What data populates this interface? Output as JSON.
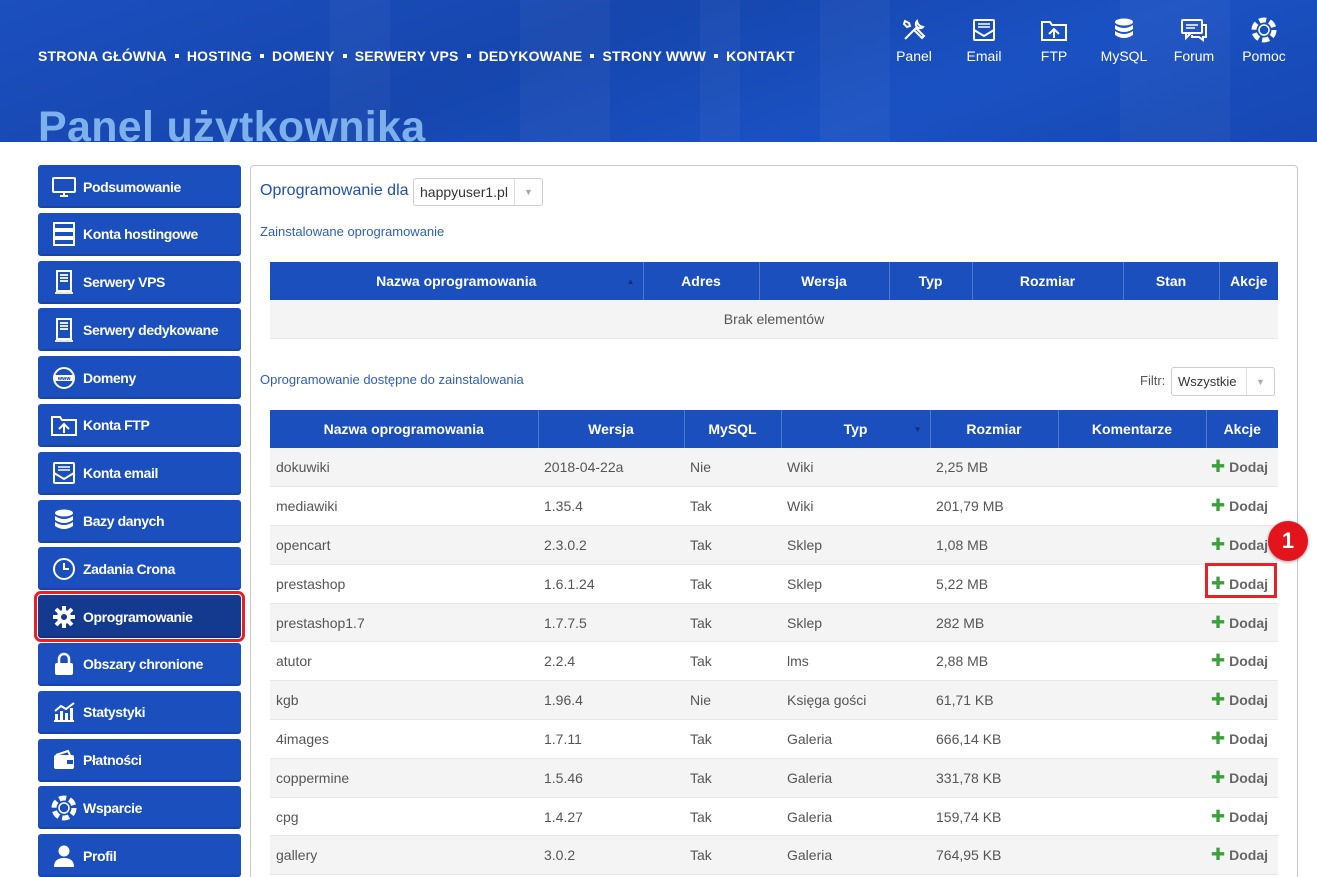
{
  "top_nav": [
    "STRONA GŁÓWNA",
    "HOSTING",
    "DOMENY",
    "SERWERY VPS",
    "DEDYKOWANE",
    "STRONY WWW",
    "KONTAKT"
  ],
  "tools": [
    {
      "label": "Panel",
      "icon": "tools-icon"
    },
    {
      "label": "Email",
      "icon": "email-icon"
    },
    {
      "label": "FTP",
      "icon": "ftp-folder-icon"
    },
    {
      "label": "MySQL",
      "icon": "database-icon"
    },
    {
      "label": "Forum",
      "icon": "forum-icon"
    },
    {
      "label": "Pomoc",
      "icon": "lifebuoy-icon"
    }
  ],
  "page_title": "Panel użytkownika",
  "sidebar": [
    {
      "label": "Podsumowanie",
      "icon": "monitor-icon"
    },
    {
      "label": "Konta hostingowe",
      "icon": "server-rack-icon"
    },
    {
      "label": "Serwery VPS",
      "icon": "server-tower-icon"
    },
    {
      "label": "Serwery dedykowane",
      "icon": "server-tower-icon"
    },
    {
      "label": "Domeny",
      "icon": "globe-www-icon"
    },
    {
      "label": "Konta FTP",
      "icon": "ftp-folder-icon"
    },
    {
      "label": "Konta email",
      "icon": "email-icon"
    },
    {
      "label": "Bazy danych",
      "icon": "database-icon"
    },
    {
      "label": "Zadania Crona",
      "icon": "clock-icon"
    },
    {
      "label": "Oprogramowanie",
      "icon": "gear-icon",
      "active": true
    },
    {
      "label": "Obszary chronione",
      "icon": "lock-icon"
    },
    {
      "label": "Statystyki",
      "icon": "chart-icon"
    },
    {
      "label": "Płatności",
      "icon": "wallet-icon"
    },
    {
      "label": "Wsparcie",
      "icon": "lifebuoy-icon"
    },
    {
      "label": "Profil",
      "icon": "user-icon"
    }
  ],
  "main": {
    "software_for_label": "Oprogramowanie dla",
    "domain_select": "happyuser1.pl",
    "installed_title": "Zainstalowane oprogramowanie",
    "installed_headers": [
      "Nazwa oprogramowania",
      "Adres",
      "Wersja",
      "Typ",
      "Rozmiar",
      "Stan",
      "Akcje"
    ],
    "installed_empty": "Brak elementów",
    "available_title": "Oprogramowanie dostępne do zainstalowania",
    "filter_label": "Filtr:",
    "filter_value": "Wszystkie",
    "available_headers": [
      "Nazwa oprogramowania",
      "Wersja",
      "MySQL",
      "Typ",
      "Rozmiar",
      "Komentarze",
      "Akcje"
    ],
    "add_label": "Dodaj",
    "rows": [
      [
        "dokuwiki",
        "2018-04-22a",
        "Nie",
        "Wiki",
        "2,25 MB"
      ],
      [
        "mediawiki",
        "1.35.4",
        "Tak",
        "Wiki",
        "201,79 MB"
      ],
      [
        "opencart",
        "2.3.0.2",
        "Tak",
        "Sklep",
        "1,08 MB"
      ],
      [
        "prestashop",
        "1.6.1.24",
        "Tak",
        "Sklep",
        "5,22 MB"
      ],
      [
        "prestashop1.7",
        "1.7.7.5",
        "Tak",
        "Sklep",
        "282 MB"
      ],
      [
        "atutor",
        "2.2.4",
        "Tak",
        "lms",
        "2,88 MB"
      ],
      [
        "kgb",
        "1.96.4",
        "Nie",
        "Księga gości",
        "61,71 KB"
      ],
      [
        "4images",
        "1.7.11",
        "Tak",
        "Galeria",
        "666,14 KB"
      ],
      [
        "coppermine",
        "1.5.46",
        "Tak",
        "Galeria",
        "331,78 KB"
      ],
      [
        "cpg",
        "1.4.27",
        "Tak",
        "Galeria",
        "159,74 KB"
      ],
      [
        "gallery",
        "3.0.2",
        "Tak",
        "Galeria",
        "764,95 KB"
      ]
    ]
  },
  "annotation": {
    "badge": "1"
  },
  "colors": {
    "brand_blue": "#1a4fbd",
    "highlight_red": "#e8202a",
    "add_green": "#3ba03b"
  }
}
